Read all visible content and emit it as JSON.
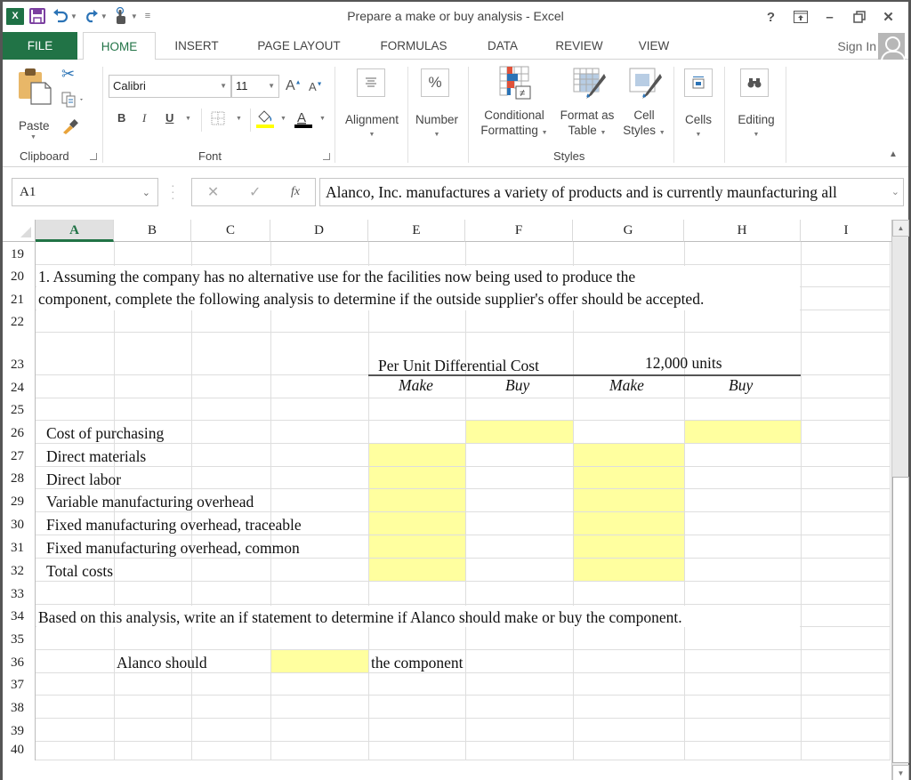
{
  "window": {
    "title": "Prepare a make or buy analysis - Excel",
    "controls": [
      "?",
      "ribbon-display-options",
      "minimize",
      "restore",
      "close"
    ]
  },
  "qat": {
    "icons": [
      "excel-logo",
      "save-icon",
      "undo-icon",
      "redo-icon",
      "touch-mode-icon",
      "customize-qat-icon"
    ]
  },
  "tabs": {
    "file": "FILE",
    "home": "HOME",
    "insert": "INSERT",
    "page_layout": "PAGE LAYOUT",
    "formulas": "FORMULAS",
    "data": "DATA",
    "review": "REVIEW",
    "view": "VIEW",
    "active": "HOME",
    "sign_in": "Sign In"
  },
  "ribbon": {
    "clipboard": {
      "label": "Clipboard",
      "paste": "Paste"
    },
    "font": {
      "label": "Font",
      "name": "Calibri",
      "size": "11",
      "bold": "B",
      "italic": "I",
      "underline": "U",
      "fill_color": "#ffff00",
      "font_color": "#000000"
    },
    "alignment": "Alignment",
    "number": {
      "label": "Number",
      "icon_text": "%"
    },
    "styles": {
      "label": "Styles",
      "conditional_formatting_1": "Conditional",
      "conditional_formatting_2": "Formatting",
      "format_as_table_1": "Format as",
      "format_as_table_2": "Table",
      "cell_styles_1": "Cell",
      "cell_styles_2": "Styles"
    },
    "cells": "Cells",
    "editing": "Editing"
  },
  "formula_bar": {
    "name_box": "A1",
    "cancel": "✕",
    "enter": "✓",
    "fx": "fx",
    "content": "Alanco, Inc. manufactures a variety of products and is currently maunfacturing all"
  },
  "sheet": {
    "columns": [
      "A",
      "B",
      "C",
      "D",
      "E",
      "F",
      "G",
      "H",
      "I"
    ],
    "selected_column": "A",
    "rows": [
      "19",
      "20",
      "21",
      "22",
      "23",
      "24",
      "25",
      "26",
      "27",
      "28",
      "29",
      "30",
      "31",
      "32",
      "33",
      "34",
      "35",
      "36",
      "37",
      "38",
      "39",
      "40"
    ],
    "cells": {
      "A20": "1. Assuming the company has no alternative use for the facilities now being used to produce the",
      "A21": "component, complete the following analysis to determine if the outside supplier's offer should be accepted.",
      "E23": "Per Unit Differential Cost",
      "G23": "12,000 units",
      "E24": "Make",
      "F24": "Buy",
      "G24": "Make",
      "H24": "Buy",
      "A26": "Cost of purchasing",
      "A27": "Direct materials",
      "A28": "Direct labor",
      "A29": "Variable manufacturing overhead",
      "A30": "Fixed manufacturing overhead, traceable",
      "A31": "Fixed manufacturing overhead, common",
      "A32": "Total costs",
      "A34": "Based on this analysis, write an if statement to determine if Alanco should make or buy the component.",
      "B36": "Alanco should",
      "D36": "",
      "E36": "the component"
    },
    "input_cell_color": "#ffff9f",
    "input_cells": [
      "F26",
      "H26",
      "E27:E32",
      "G27:G32",
      "D36"
    ]
  }
}
